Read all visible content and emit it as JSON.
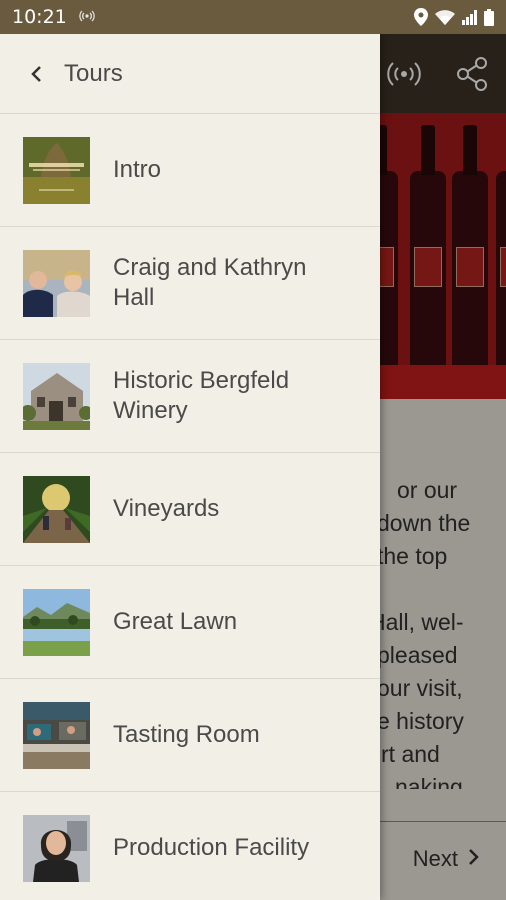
{
  "status_bar": {
    "time": "10:21",
    "left_icon": "broadcast-icon",
    "right_icons": [
      "location-icon",
      "wifi-icon",
      "signal-icon",
      "battery-icon"
    ]
  },
  "background": {
    "toolbar_icons": [
      "broadcast-icon",
      "share-icon"
    ],
    "body_lines": [
      "or our",
      "down the",
      "the top",
      "",
      "Hall, wel-",
      "pleased",
      "our visit,",
      "e history",
      "rt and",
      "naking"
    ],
    "next_label": "Next"
  },
  "drawer": {
    "title": "Tours",
    "items": [
      {
        "label": "Intro",
        "thumb": "intro-thumbnail"
      },
      {
        "label": "Craig and Kathryn Hall",
        "thumb": "owners-thumbnail"
      },
      {
        "label": "Historic Bergfeld Winery",
        "thumb": "stone-building-thumbnail"
      },
      {
        "label": "Vineyards",
        "thumb": "vineyard-thumbnail"
      },
      {
        "label": "Great Lawn",
        "thumb": "lawn-thumbnail"
      },
      {
        "label": "Tasting Room",
        "thumb": "tasting-room-thumbnail"
      },
      {
        "label": "Production Facility",
        "thumb": "person-portrait-thumbnail"
      }
    ]
  },
  "colors": {
    "status_bar": "#6b5b3e",
    "toolbar": "#3d3327",
    "hero_red": "#a31a1a",
    "drawer_bg": "#f2efe6",
    "text": "#4a4a4a"
  }
}
